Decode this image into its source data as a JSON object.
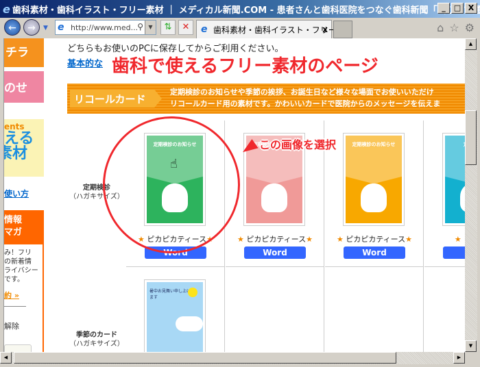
{
  "window": {
    "title": "歯科素材・歯科イラスト・フリー素材 ｜ メディカル新聞.COM - 患者さんと歯科医院をつなぐ歯科新聞「歯びスマ通信...",
    "minimize": "_",
    "maximize": "□",
    "close": "X"
  },
  "toolbar": {
    "address": "http://www.med...",
    "tab_title": "歯科素材・歯科イラスト・フリー...",
    "tab_close": "x"
  },
  "sidebar": {
    "item1": "チラ",
    "item2": "のせ",
    "banner_top": "ents",
    "banner_main1": "える",
    "banner_main2": "素材",
    "howto_link": "使い方",
    "mag_header1": "情報",
    "mag_header2": "マガ",
    "mag_text": [
      "み！フリ",
      "の新着情",
      "ライバシー",
      "です。"
    ],
    "terms_link": "約 »",
    "unsubscribe": "解除"
  },
  "content": {
    "intro": "どちらもお使いのPCに保存してからご利用ください。",
    "basic_link": "基本的な",
    "overlay_title": "歯科で使えるフリー素材のページ",
    "section": {
      "label": "リコールカード",
      "desc1": "定期検診のお知らせや季節の挨拶、お誕生日など様々な場面でお使いいただけ",
      "desc2": "リコールカード用の素材です。かわいいカードで医院からのメッセージを伝えま"
    },
    "annotation": "この画像を選択",
    "rows": [
      {
        "label": "定期検診",
        "sub": "（ハガキサイズ）",
        "cards": [
          {
            "title": "定期検診のお知らせ",
            "name": "ピカピカティース",
            "button": "Word",
            "color": "#2db35d"
          },
          {
            "title": "定期検診のお知らせ",
            "name": "ピカピカティース",
            "button": "Word",
            "color": "#f09a98"
          },
          {
            "title": "定期検診のお知らせ",
            "name": "ピカピカティース",
            "button": "Word",
            "color": "#f8a800"
          },
          {
            "title": "定期検診",
            "name": "ピカピ",
            "button": "W",
            "color": "#13b0cf"
          }
        ]
      },
      {
        "label": "季節のカード",
        "sub": "（ハガキサイズ）",
        "cards": [
          {
            "title": "暑中お見舞い申し上げます",
            "color": "#a8d8f5"
          }
        ]
      }
    ]
  },
  "colors": {
    "accent_red": "#f0282d",
    "orange": "#f08a00",
    "word_button": "#3366ff"
  }
}
